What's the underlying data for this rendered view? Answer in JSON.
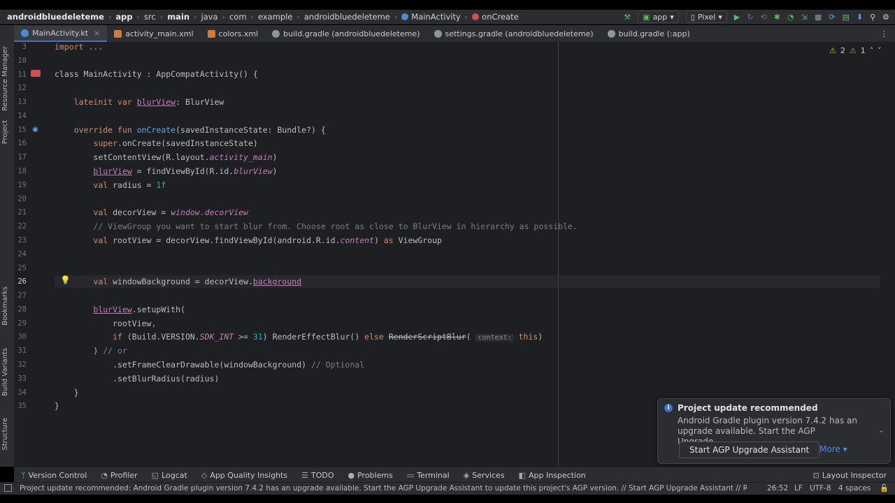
{
  "breadcrumbs": [
    "androidbluedeleteme",
    "app",
    "src",
    "main",
    "java",
    "com",
    "example",
    "androidbluedeleteme",
    "MainActivity",
    "onCreate"
  ],
  "run_config": "app",
  "device": "Pixel",
  "tabs": [
    {
      "label": "MainActivity.kt",
      "icon": "kotlin-class-icon"
    },
    {
      "label": "activity_main.xml",
      "icon": "xml-icon"
    },
    {
      "label": "colors.xml",
      "icon": "xml-icon"
    },
    {
      "label": "build.gradle (androidbluedeleteme)",
      "icon": "gradle-icon"
    },
    {
      "label": "settings.gradle (androidbluedeleteme)",
      "icon": "gradle-icon"
    },
    {
      "label": "build.gradle (:app)",
      "icon": "gradle-icon"
    }
  ],
  "left_panels": [
    "Resource Manager",
    "Project",
    "Bookmarks",
    "Build Variants",
    "Structure"
  ],
  "inspections": {
    "warnings": "2",
    "weak_warnings": "1"
  },
  "line_numbers": [
    "3",
    "10",
    "11",
    "12",
    "13",
    "14",
    "15",
    "16",
    "17",
    "18",
    "19",
    "20",
    "21",
    "22",
    "23",
    "24",
    "25",
    "26",
    "27",
    "28",
    "29",
    "30",
    "31",
    "32",
    "33",
    "34",
    "35"
  ],
  "code": {
    "l3": "import ...",
    "l11": "class MainActivity : AppCompatActivity() {",
    "l13a": "lateinit var ",
    "l13b": "blurView",
    "l13c": ": BlurView",
    "l15a": "override fun ",
    "l15b": "onCreate",
    "l15c": "(savedInstanceState: Bundle?) {",
    "l16a": "super",
    "l16b": ".onCreate(savedInstanceState)",
    "l17a": "setContentView(R.layout.",
    "l17b": "activity_main",
    "l17c": ")",
    "l18a": "blurView",
    "l18b": " = findViewById(R.id.",
    "l18c": "blurView",
    "l18d": ")",
    "l19a": "val",
    "l19b": " radius = ",
    "l19c": "1f",
    "l21a": "val",
    "l21b": " decorView = ",
    "l21c": "window.decorView",
    "l22": "// ViewGroup you want to start blur from. Choose root as close to BlurView in hierarchy as possible.",
    "l23a": "val",
    "l23b": " rootView = decorView.findViewById(android.R.id.",
    "l23c": "content",
    "l23d": ") ",
    "l23e": "as",
    "l23f": " ViewGroup",
    "l26a": "val",
    "l26b": " windowBackground = decorView.",
    "l26c": "background",
    "l28a": "blurView",
    "l28b": ".setupWith(",
    "l29a": "rootView",
    "l29b": ",",
    "l30a": "if",
    "l30b": " (Build.VERSION.",
    "l30c": "SDK_INT",
    "l30d": " >= ",
    "l30e": "31",
    "l30f": ") RenderEffectBlur() ",
    "l30g": "else",
    "l30h": " ",
    "l30i": "RenderScriptBlur",
    "l30j": "(",
    "l30hint": "context:",
    "l30k": "this",
    "l30l": ")",
    "l31a": ") ",
    "l31b": "// or",
    "l32a": ".setFrameClearDrawable(windowBackground) ",
    "l32b": "// Optional",
    "l33": ".setBlurRadius(radius)",
    "l34": "}",
    "l35": "}"
  },
  "notification": {
    "title": "Project update recommended",
    "body": "Android Gradle plugin version 7.4.2 has an upgrade available. Start the AGP Upgrade...",
    "button": "Start AGP Upgrade Assistant",
    "more": "More ▾"
  },
  "tool_windows": [
    "Version Control",
    "Profiler",
    "Logcat",
    "App Quality Insights",
    "TODO",
    "Problems",
    "Terminal",
    "Services",
    "App Inspection"
  ],
  "layout_inspector": "Layout Inspector",
  "status": {
    "message": "Project update recommended: Android Gradle plugin version 7.4.2 has an upgrade available.  Start the AGP Upgrade Assistant to update this project's AGP version. // Start AGP Upgrade Assistant // Remind ... (a minute agc",
    "position": "26:52",
    "line_sep": "LF",
    "encoding": "UTF-8",
    "indent": "4 spaces"
  },
  "colors": {
    "accent": "#3d74c9",
    "keyword": "#cf8e6d",
    "function": "#56a8f5",
    "property": "#c77dbb",
    "number": "#2aacb8",
    "comment": "#7a7e85"
  }
}
